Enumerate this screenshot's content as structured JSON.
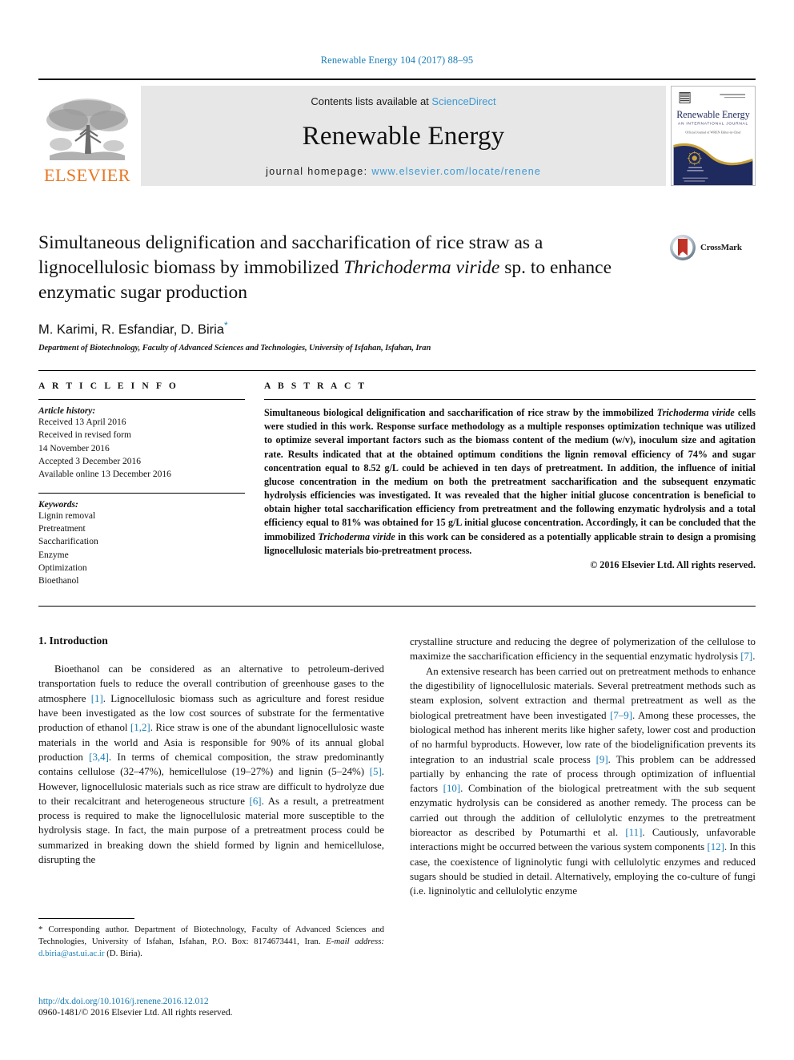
{
  "running_head": "Renewable Energy 104 (2017) 88–95",
  "masthead": {
    "publisher_logo_label": "ELSEVIER",
    "contents_prefix": "Contents lists available at",
    "contents_link": "ScienceDirect",
    "journal_title": "Renewable Energy",
    "homepage_prefix": "journal homepage:",
    "homepage_url": "www.elsevier.com/locate/renene",
    "cover": {
      "title": "Renewable Energy",
      "subtitle": "AN INTERNATIONAL JOURNAL",
      "tagline": "Official Journal of WREN / Editor in Chief: Soteris Kalogirou"
    }
  },
  "colors": {
    "link_blue": "#1a7db6",
    "sciencedirect_blue": "#3b9ad4",
    "elsevier_orange": "#E87722",
    "masthead_gray": "#e7e7e7",
    "cover_navy": "#1f2a5e",
    "cover_gold": "#c8a23c",
    "crossmark_red": "#c1352b"
  },
  "article": {
    "title_part1": "Simultaneous delignification and saccharification of rice straw as a lignocellulosic biomass by immobilized ",
    "title_italic": "Thrichoderma viride",
    "title_part2": " sp. to enhance enzymatic sugar production",
    "authors": "M. Karimi, R. Esfandiar, D. Biria",
    "corresponding_marker": "*",
    "affiliation": "Department of Biotechnology, Faculty of Advanced Sciences and Technologies, University of Isfahan, Isfahan, Iran",
    "crossmark_label": "CrossMark"
  },
  "article_info": {
    "heading": "A R T I C L E   I N F O",
    "history_label": "Article history:",
    "history": [
      "Received 13 April 2016",
      "Received in revised form",
      "14 November 2016",
      "Accepted 3 December 2016",
      "Available online 13 December 2016"
    ],
    "keywords_label": "Keywords:",
    "keywords": [
      "Lignin removal",
      "Pretreatment",
      "Saccharification",
      "Enzyme",
      "Optimization",
      "Bioethanol"
    ]
  },
  "abstract": {
    "heading": "A B S T R A C T",
    "para_1": "Simultaneous biological delignification and saccharification of rice straw by the immobilized ",
    "italic_1": "Trichoderma viride",
    "para_2": " cells were studied in this work. Response surface methodology as a multiple responses optimization technique was utilized to optimize several important factors such as the biomass content of the medium (w/v), inoculum size and agitation rate. Results indicated that at the obtained optimum conditions the lignin removal efficiency of 74% and sugar concentration equal to 8.52 g/L could be achieved in ten days of pretreatment. In addition, the influence of initial glucose concentration in the medium on both the pretreatment saccharification and the subsequent enzymatic hydrolysis efficiencies was investigated. It was revealed that the higher initial glucose concentration is beneficial to obtain higher total saccharification efficiency from pretreatment and the following enzymatic hydrolysis and a total efficiency equal to 81% was obtained for 15 g/L initial glucose concentration. Accordingly, it can be concluded that the immobilized ",
    "italic_2": "Trichoderma viride",
    "para_3": " in this work can be considered as a potentially applicable strain to design a promising lignocellulosic materials bio-pretreatment process.",
    "copyright": "© 2016 Elsevier Ltd. All rights reserved."
  },
  "body": {
    "section_heading": "1. Introduction",
    "left_column": {
      "p1_a": "Bioethanol can be considered as an alternative to petroleum-derived transportation fuels to reduce the overall contribution of greenhouse gases to the atmosphere ",
      "r1": "[1]",
      "p1_b": ". Lignocellulosic biomass such as agriculture and forest residue have been investigated as the low cost sources of substrate for the fermentative production of ethanol ",
      "r2": "[1,2]",
      "p1_c": ". Rice straw is one of the abundant lignocellulosic waste materials in the world and Asia is responsible for 90% of its annual global production ",
      "r3": "[3,4]",
      "p1_d": ". In terms of chemical composition, the straw predominantly contains cellulose (32–47%), hemicellulose (19–27%) and lignin (5–24%) ",
      "r4": "[5]",
      "p1_e": ". However, lignocellulosic materials such as rice straw are difficult to hydrolyze due to their recalcitrant and heterogeneous structure ",
      "r5": "[6]",
      "p1_f": ". As a result, a pretreatment process is required to make the lignocellulosic material more susceptible to the hydrolysis stage. In fact, the main purpose of a pretreatment process could be summarized in breaking down the shield formed by lignin and hemicellulose, disrupting the"
    },
    "right_column": {
      "p1_cont_a": "crystalline structure and reducing the degree of polymerization of the cellulose to maximize the saccharification efficiency in the sequential enzymatic hydrolysis ",
      "r6": "[7]",
      "p1_cont_b": ".",
      "p2_a": "An extensive research has been carried out on pretreatment methods to enhance the digestibility of lignocellulosic materials. Several pretreatment methods such as steam explosion, solvent extraction and thermal pretreatment as well as the biological pretreatment have been investigated ",
      "r7": "[7–9]",
      "p2_b": ". Among these processes, the biological method has inherent merits like higher safety, lower cost and production of no harmful byproducts. However, low rate of the biodelignification prevents its integration to an industrial scale process ",
      "r8": "[9]",
      "p2_c": ". This problem can be addressed partially by enhancing the rate of process through optimization of influential factors ",
      "r9": "[10]",
      "p2_d": ". Combination of the biological pretreatment with the sub sequent enzymatic hydrolysis can be considered as another remedy. The process can be carried out through the addition of cellulolytic enzymes to the pretreatment bioreactor as described by Potumarthi et al. ",
      "r10": "[11]",
      "p2_e": ". Cautiously, unfavorable interactions might be occurred between the various system components ",
      "r11": "[12]",
      "p2_f": ". In this case, the coexistence of ligninolytic fungi with cellulolytic enzymes and reduced sugars should be studied in detail. Alternatively, employing the co-culture of fungi (i.e. ligninolytic and cellulolytic enzyme"
    }
  },
  "footnote": {
    "star": "*",
    "text": " Corresponding author. Department of Biotechnology, Faculty of Advanced Sciences and Technologies, University of Isfahan, Isfahan, P.O. Box: 8174673441, Iran.",
    "email_label": "E-mail address:",
    "email": "d.biria@ast.ui.ac.ir",
    "email_suffix": "(D. Biria)."
  },
  "footer": {
    "doi": "http://dx.doi.org/10.1016/j.renene.2016.12.012",
    "issn_line": "0960-1481/© 2016 Elsevier Ltd. All rights reserved."
  }
}
